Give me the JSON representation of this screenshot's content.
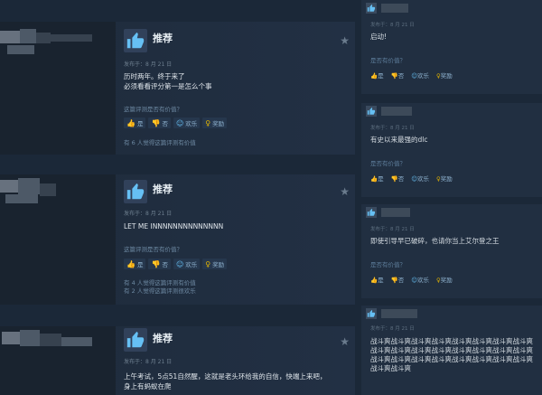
{
  "reviews": [
    {
      "recommend_label": "推荐",
      "posted": "发布于：8 月 21 日",
      "text_lines": [
        "历时两年。终于来了",
        "必须看看评分第一是怎么个事"
      ],
      "helpful_question": "这篇评测是否有价值？",
      "votes": {
        "yes": "是",
        "no": "否",
        "funny": "欢乐",
        "award": "奖励"
      },
      "counts": [
        "有 6 人觉得这篇评测有价值"
      ]
    },
    {
      "recommend_label": "推荐",
      "posted": "发布于：8 月 21 日",
      "text_lines": [
        "LET ME INNNNNNNNNNNNNN"
      ],
      "helpful_question": "这篇评测是否有价值？",
      "votes": {
        "yes": "是",
        "no": "否",
        "funny": "欢乐",
        "award": "奖励"
      },
      "counts": [
        "有 4 人觉得这篇评测有价值",
        "有 2 人觉得这篇评测很欢乐"
      ]
    },
    {
      "recommend_label": "推荐",
      "posted": "发布于：8 月 21 日",
      "text_lines": [
        "上午考试，5点51自然醒，这就是老头环给我的自信，快端上来吧，",
        "身上有蚂蚁在爬"
      ]
    }
  ],
  "comments": [
    {
      "posted": "发布于：8 月 21 日",
      "text": "启动!",
      "helpful_question": "是否有价值？",
      "votes": {
        "yes": "是",
        "no": "否",
        "funny": "欢乐",
        "award": "奖励"
      }
    },
    {
      "posted": "发布于：8 月 21 日",
      "text": "有史以来最强的dlc",
      "helpful_question": "是否有价值？",
      "votes": {
        "yes": "是",
        "no": "否",
        "funny": "欢乐",
        "award": "奖励"
      }
    },
    {
      "posted": "发布于：8 月 21 日",
      "text": "即使引导早已破碎，也请你当上艾尔登之王",
      "helpful_question": "是否有价值？",
      "votes": {
        "yes": "是",
        "no": "否",
        "funny": "欢乐",
        "award": "奖励"
      }
    },
    {
      "posted": "发布于：8 月 21 日",
      "text": "战斗爽战斗爽战斗爽战斗爽战斗爽战斗爽战斗爽战斗爽战斗爽战斗爽战斗爽战斗爽战斗爽战斗爽战斗爽战斗爽战斗爽战斗爽战斗爽战斗爽战斗爽战斗爽战斗爽战斗爽战斗爽战斗爽"
    }
  ],
  "colors": {
    "accent": "#66c0f4",
    "award": "#e7b700",
    "background": "#1b2838"
  }
}
